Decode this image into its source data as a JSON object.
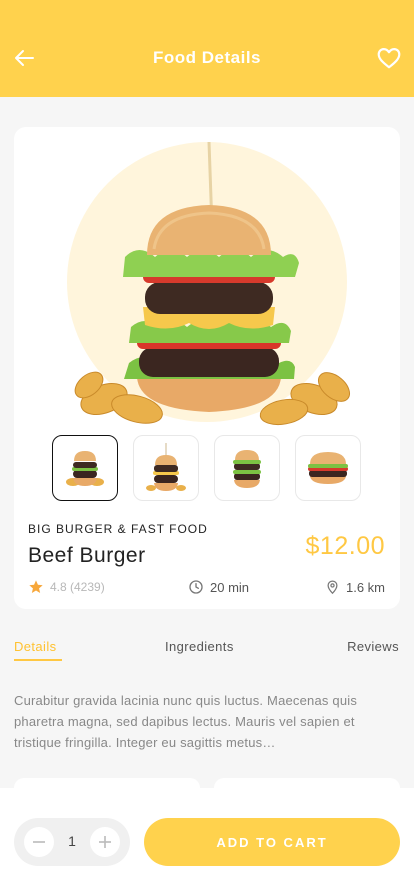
{
  "header": {
    "title": "Food Details",
    "back_icon": "arrow-left-icon",
    "favorite_icon": "heart-outline-icon"
  },
  "product": {
    "category": "BIG BURGER & FAST FOOD",
    "name": "Beef Burger",
    "price": "$12.00",
    "rating": "4.8 (4239)",
    "time": "20 min",
    "distance": "1.6 km",
    "thumbnails": [
      "burger-fries",
      "burger-tall",
      "burger-double",
      "burger-side"
    ],
    "selected_thumbnail": 0
  },
  "tabs": [
    {
      "label": "Details",
      "active": true
    },
    {
      "label": "Ingredients",
      "active": false
    },
    {
      "label": "Reviews",
      "active": false
    }
  ],
  "description": "Curabitur gravida lacinia nunc quis luctus. Maecenas quis pharetra magna, sed dapibus lectus. Mauris vel sapien et tristique fringilla. Integer eu sagittis metus…",
  "cart": {
    "quantity": "1",
    "button_label": "ADD TO CART"
  },
  "colors": {
    "accent": "#ffd24d",
    "price": "#ffc843",
    "star": "#f7a73a"
  }
}
